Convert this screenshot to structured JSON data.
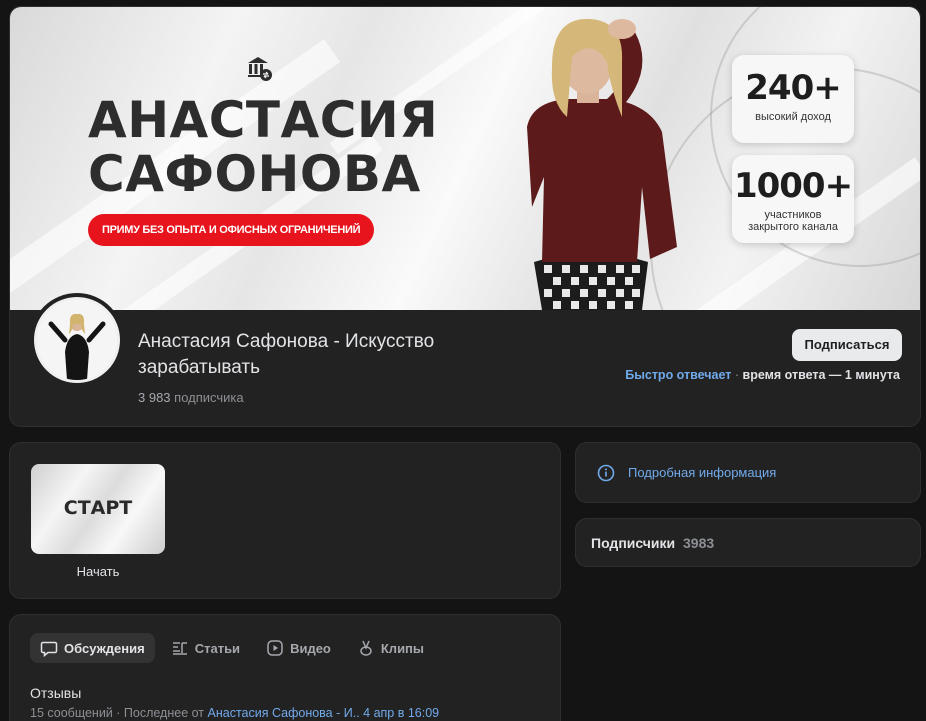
{
  "cover": {
    "name_line1": "АНАСТАСИЯ",
    "name_line2": "САФОНОВА",
    "tagline": "ПРИМУ БЕЗ ОПЫТА И ОФИСНЫХ ОГРАНИЧЕНИЙ",
    "stats": [
      {
        "number": "240+",
        "caption_line1": "высокий доход",
        "caption_line2": ""
      },
      {
        "number": "1000+",
        "caption_line1": "участников",
        "caption_line2": "закрытого канала"
      }
    ],
    "accent_color": "#e7141d"
  },
  "profile": {
    "name": "Анастасия Сафонова - Искусство зарабатывать",
    "subscribers_count": "3 983",
    "subscribers_label": "подписчика",
    "subscribe_label": "Подписаться",
    "reply_fast": "Быстро отвечает",
    "reply_sep": " · ",
    "reply_time": "время ответа — 1 минута"
  },
  "start": {
    "tile_text": "СТАРТ",
    "label": "Начать"
  },
  "info": {
    "icon": "info-icon",
    "link_label": "Подробная информация"
  },
  "followers": {
    "label": "Подписчики",
    "count": "3983"
  },
  "discussions": {
    "tabs": [
      {
        "label": "Обсуждения",
        "icon": "chat-icon",
        "active": true
      },
      {
        "label": "Статьи",
        "icon": "articles-icon",
        "active": false
      },
      {
        "label": "Видео",
        "icon": "video-icon",
        "active": false
      },
      {
        "label": "Клипы",
        "icon": "clips-icon",
        "active": false
      }
    ],
    "topic": {
      "title": "Отзывы",
      "meta_prefix": "15 сообщений · Последнее от ",
      "author": "Анастасия Сафонова - И..",
      "date": "4 апр в 16:09"
    }
  },
  "colors": {
    "background": "#141414",
    "card": "#222222",
    "link": "#71aaeb",
    "text_secondary": "#8c8f94"
  }
}
